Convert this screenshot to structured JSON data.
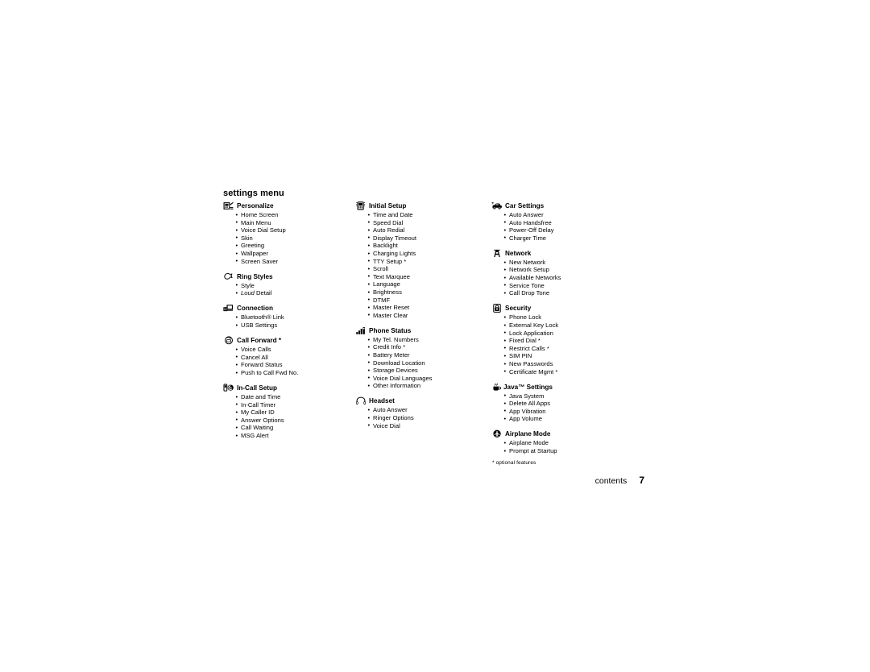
{
  "page": {
    "title": "settings menu",
    "footnote": "* optional features",
    "folio_label": "contents",
    "folio_number": "7"
  },
  "columns": [
    {
      "sections": [
        {
          "icon": "personalize-icon",
          "heading": "Personalize",
          "items": [
            "Home Screen",
            "Main Menu",
            "Voice Dial Setup",
            "Skin",
            "Greeting",
            "Wallpaper",
            "Screen Saver"
          ]
        },
        {
          "icon": "ring-styles-icon",
          "heading": "Ring Styles",
          "items": [
            "Style",
            "Loud Detail"
          ],
          "italic_items": [
            {
              "index": 1,
              "italic": "Loud",
              "rest": " Detail"
            }
          ]
        },
        {
          "icon": "connection-icon",
          "heading": "Connection",
          "items": [
            "Bluetooth® Link",
            "USB Settings"
          ]
        },
        {
          "icon": "call-forward-icon",
          "heading": "Call Forward *",
          "items": [
            "Voice Calls",
            "Cancel All",
            "Forward Status",
            "Push to Call Fwd No."
          ]
        },
        {
          "icon": "in-call-setup-icon",
          "heading": "In-Call Setup",
          "items": [
            "Date and Time",
            "In-Call Timer",
            "My Caller ID",
            "Answer Options",
            "Call Waiting",
            "MSG Alert"
          ]
        }
      ]
    },
    {
      "sections": [
        {
          "icon": "initial-setup-icon",
          "heading": "Initial Setup",
          "items": [
            "Time and Date",
            "Speed Dial",
            "Auto Redial",
            "Display Timeout",
            "Backlight",
            "Charging Lights",
            "TTY Setup *",
            "Scroll",
            "Text Marquee",
            "Language",
            "Brightness",
            "DTMF",
            "Master Reset",
            "Master Clear"
          ]
        },
        {
          "icon": "phone-status-icon",
          "heading": "Phone Status",
          "items": [
            "My Tel. Numbers",
            "Credit Info *",
            "Battery Meter",
            "Download Location",
            "Storage Devices",
            "Voice Dial Languages",
            "Other Information"
          ]
        },
        {
          "icon": "headset-icon",
          "heading": "Headset",
          "items": [
            "Auto Answer",
            "Ringer Options",
            "Voice Dial"
          ]
        }
      ]
    },
    {
      "sections": [
        {
          "icon": "car-settings-icon",
          "heading": "Car Settings",
          "items": [
            "Auto Answer",
            "Auto Handsfree",
            "Power-Off Delay",
            "Charger Time"
          ]
        },
        {
          "icon": "network-icon",
          "heading": "Network",
          "items": [
            "New Network",
            "Network Setup",
            "Available Networks",
            "Service Tone",
            "Call Drop Tone"
          ]
        },
        {
          "icon": "security-icon",
          "heading": "Security",
          "items": [
            "Phone Lock",
            "External Key Lock",
            "Lock Application",
            "Fixed Dial *",
            "Restrict Calls *",
            "SIM PIN",
            "New Passwords",
            "Certificate Mgmt *"
          ]
        },
        {
          "icon": "java-settings-icon",
          "heading": "Java™ Settings",
          "tight": true,
          "items": [
            "Java System",
            "Delete All Apps",
            "App Vibration",
            "App Volume"
          ]
        },
        {
          "icon": "airplane-mode-icon",
          "heading": "Airplane Mode",
          "items": [
            "Airplane Mode",
            "Prompt at Startup"
          ]
        }
      ]
    }
  ]
}
